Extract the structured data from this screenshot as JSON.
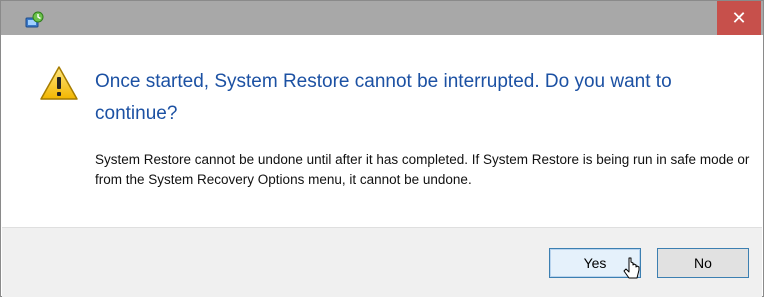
{
  "window": {
    "icon": "system-restore-icon",
    "close_icon": "close-icon",
    "close_glyph": "✕"
  },
  "message": {
    "icon": "warning-icon",
    "heading": "Once started, System Restore cannot be interrupted. Do you want to continue?",
    "body": "System Restore cannot be undone until after it has completed. If System Restore is being run in safe mode or from the System Recovery Options menu, it cannot be undone."
  },
  "buttons": {
    "yes_label": "Yes",
    "no_label": "No"
  },
  "colors": {
    "heading": "#1c51a3",
    "close_button": "#c7504b",
    "titlebar": "#a8a8a8",
    "footer": "#f0f0f0"
  }
}
